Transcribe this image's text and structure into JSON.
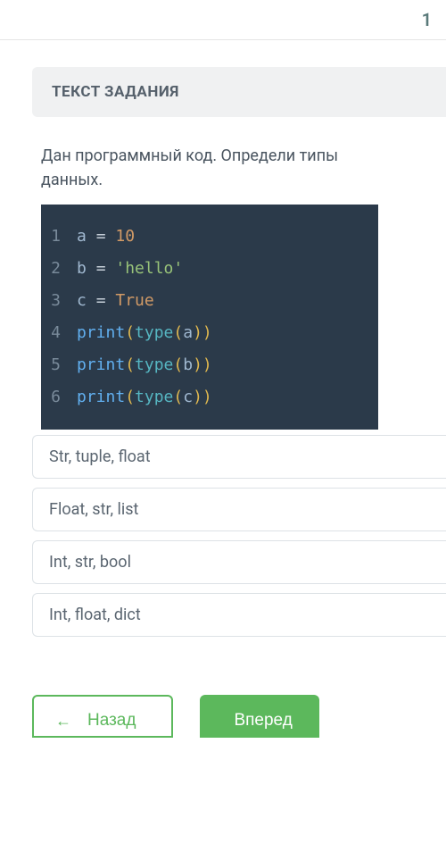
{
  "topbar": {
    "left_partial": "",
    "right_partial": "1"
  },
  "section": {
    "title": "ТЕКСТ ЗАДАНИЯ"
  },
  "question": {
    "line1": "Дан программный код. Определи типы",
    "line2": "данных."
  },
  "code": {
    "lines": [
      {
        "num": "1",
        "tokens": [
          {
            "t": "var",
            "v": "a"
          },
          {
            "t": "sp",
            "v": " "
          },
          {
            "t": "op",
            "v": "="
          },
          {
            "t": "sp",
            "v": " "
          },
          {
            "t": "num",
            "v": "10"
          }
        ]
      },
      {
        "num": "2",
        "tokens": [
          {
            "t": "var",
            "v": "b"
          },
          {
            "t": "sp",
            "v": " "
          },
          {
            "t": "op",
            "v": "="
          },
          {
            "t": "sp",
            "v": " "
          },
          {
            "t": "str",
            "v": "'hello'"
          }
        ]
      },
      {
        "num": "3",
        "tokens": [
          {
            "t": "var",
            "v": "c"
          },
          {
            "t": "sp",
            "v": " "
          },
          {
            "t": "op",
            "v": "="
          },
          {
            "t": "sp",
            "v": " "
          },
          {
            "t": "bool",
            "v": "True"
          }
        ]
      },
      {
        "num": "4",
        "tokens": [
          {
            "t": "fn",
            "v": "print"
          },
          {
            "t": "pun",
            "v": "("
          },
          {
            "t": "kw",
            "v": "type"
          },
          {
            "t": "pun",
            "v": "("
          },
          {
            "t": "var",
            "v": "a"
          },
          {
            "t": "pun",
            "v": ")"
          },
          {
            "t": "pun",
            "v": ")"
          }
        ]
      },
      {
        "num": "5",
        "tokens": [
          {
            "t": "fn",
            "v": "print"
          },
          {
            "t": "pun",
            "v": "("
          },
          {
            "t": "kw",
            "v": "type"
          },
          {
            "t": "pun",
            "v": "("
          },
          {
            "t": "var",
            "v": "b"
          },
          {
            "t": "pun",
            "v": ")"
          },
          {
            "t": "pun",
            "v": ")"
          }
        ]
      },
      {
        "num": "6",
        "tokens": [
          {
            "t": "fn",
            "v": "print"
          },
          {
            "t": "pun",
            "v": "("
          },
          {
            "t": "kw",
            "v": "type"
          },
          {
            "t": "pun",
            "v": "("
          },
          {
            "t": "var",
            "v": "c"
          },
          {
            "t": "pun",
            "v": ")"
          },
          {
            "t": "pun",
            "v": ")"
          }
        ]
      }
    ]
  },
  "options": [
    "Str, tuple, float",
    "Float, str, list",
    "Int, str, bool",
    "Int, float, dict"
  ],
  "buttons": {
    "back": "Назад",
    "forward": "Вперед",
    "back_arrow": "←"
  }
}
